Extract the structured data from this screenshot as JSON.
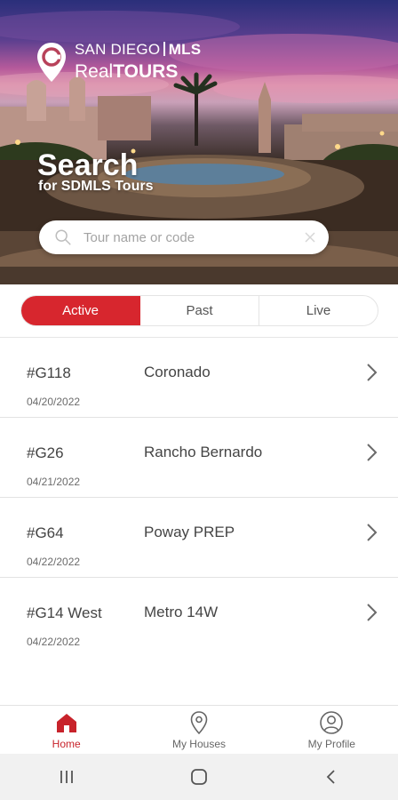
{
  "brand": {
    "line1_left": "SAN DIEGO",
    "line1_right": "MLS",
    "line2_light": "Real",
    "line2_bold": "TOURS"
  },
  "hero": {
    "title": "Search",
    "subtitle": "for SDMLS Tours"
  },
  "search": {
    "placeholder": "Tour name or code",
    "value": ""
  },
  "tabs": [
    {
      "label": "Active",
      "selected": true
    },
    {
      "label": "Past",
      "selected": false
    },
    {
      "label": "Live",
      "selected": false
    }
  ],
  "tours": [
    {
      "code": "#G118",
      "name": "Coronado",
      "date": "04/20/2022"
    },
    {
      "code": "#G26",
      "name": "Rancho Bernardo",
      "date": "04/21/2022"
    },
    {
      "code": "#G64",
      "name": "Poway PREP",
      "date": "04/22/2022"
    },
    {
      "code": "#G14 West",
      "name": "Metro 14W",
      "date": "04/22/2022"
    }
  ],
  "bottom_nav": [
    {
      "label": "Home",
      "icon": "home-icon",
      "active": true
    },
    {
      "label": "My Houses",
      "icon": "location-pin-icon",
      "active": false
    },
    {
      "label": "My Profile",
      "icon": "profile-icon",
      "active": false
    }
  ],
  "system_nav": {
    "icons": [
      "recent-apps-icon",
      "home-button-icon",
      "back-icon"
    ]
  },
  "colors": {
    "accent": "#d7262e",
    "text": "#444444",
    "muted": "#6b6b6b",
    "divider": "#e2e2e2"
  }
}
